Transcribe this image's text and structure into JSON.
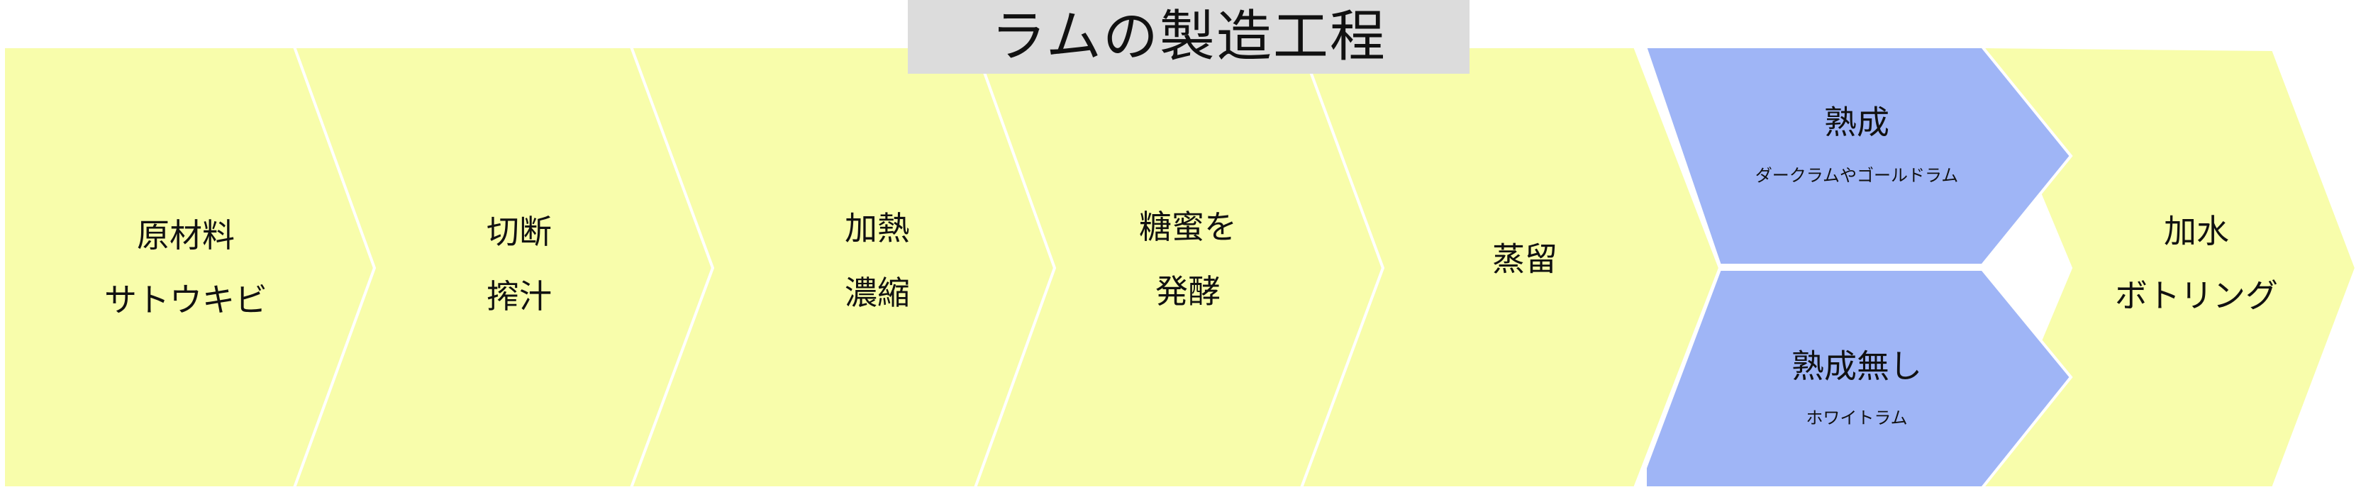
{
  "title": "ラムの製造工程",
  "steps": [
    {
      "line1": "原材料",
      "line2": "サトウキビ"
    },
    {
      "line1": "切断",
      "line2": "搾汁"
    },
    {
      "line1": "加熱",
      "line2": "濃縮"
    },
    {
      "line1": "糖蜜を",
      "line2": "発酵"
    },
    {
      "line1": "蒸留"
    },
    {
      "line1": "加水",
      "line2": "ボトリング"
    }
  ],
  "branches": [
    {
      "label": "熟成",
      "sublabel": "ダークラムやゴールドラム"
    },
    {
      "label": "熟成無し",
      "sublabel": "ホワイトラム"
    }
  ],
  "colors": {
    "step_fill": "#f8fdab",
    "branch_fill": "#9fb5f6",
    "title_bg": "#dcdcdc"
  }
}
